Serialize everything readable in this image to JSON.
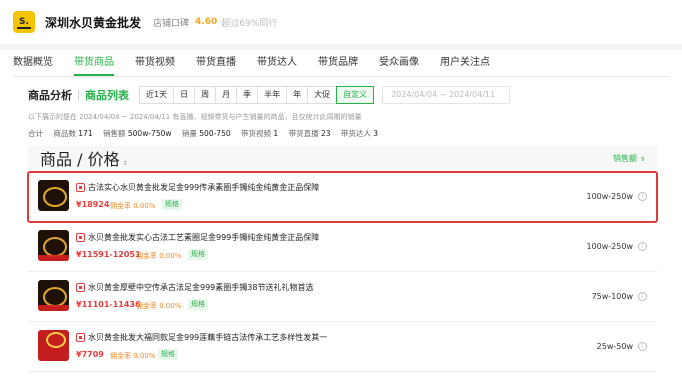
{
  "header": {
    "logo_text": "S.",
    "shop_name": "深圳水贝黄金批发",
    "rating_label": "店铺口碑",
    "rating_value": "4.60",
    "rating_sub": "超过69%同行"
  },
  "tabs": [
    {
      "label": "数据概览",
      "active": false
    },
    {
      "label": "带货商品",
      "active": true
    },
    {
      "label": "带货视频",
      "active": false
    },
    {
      "label": "带货直播",
      "active": false
    },
    {
      "label": "带货达人",
      "active": false
    },
    {
      "label": "带货品牌",
      "active": false
    },
    {
      "label": "受众画像",
      "active": false
    },
    {
      "label": "用户关注点",
      "active": false
    }
  ],
  "filter": {
    "section_title": "商品分析",
    "active_view": "商品列表",
    "periods": [
      "近1天",
      "日",
      "周",
      "月",
      "季",
      "半年",
      "年",
      "大促",
      "自定义"
    ],
    "active_period": "自定义",
    "date_range": "2024/04/04 ~ 2024/04/11"
  },
  "notice": "以下展示的是在 2024/04/04 ~ 2024/04/11 有直播、视频带货与产生销量的商品，且仅统计此周期的销量",
  "stats": {
    "total_label": "合计",
    "product_count_label": "商品数",
    "product_count": "171",
    "sales_amount_label": "销售额",
    "sales_amount": "500w-750w",
    "sales_volume_label": "销量",
    "sales_volume": "500-750",
    "video_label": "带货视频",
    "video": "1",
    "live_label": "带货直播",
    "live": "23",
    "influencer_label": "带货达人",
    "influencer": "3"
  },
  "table": {
    "col_product": "商品 / 价格",
    "col_sales": "销售额",
    "rows": [
      {
        "title": "古法实心水贝黄金批发足金999传承素圈手镯纯金纯黄金正品保障",
        "price": "¥18924",
        "commission": "佣金率 0.00%",
        "spec": "规格",
        "sales": "100w-250w",
        "selected": true
      },
      {
        "title": "水贝黄金批发实心古法工艺素圈足金999手镯纯金纯黄金正品保障",
        "price": "¥11591-12051",
        "commission": "佣金率 0.00%",
        "spec": "规格",
        "sales": "100w-250w",
        "selected": false
      },
      {
        "title": "水贝黄金厚壁中空传承古法足金999素圈手镯38节送礼礼物首选",
        "price": "¥11101-11436",
        "commission": "佣金率 0.00%",
        "spec": "规格",
        "sales": "75w-100w",
        "selected": false
      },
      {
        "title": "水贝黄金批发大福同款足金999莲藕手链古法传承工艺多样性发其一",
        "price": "¥7709",
        "commission": "佣金率 0.00%",
        "spec": "规格",
        "sales": "25w-50w",
        "selected": false
      }
    ]
  }
}
